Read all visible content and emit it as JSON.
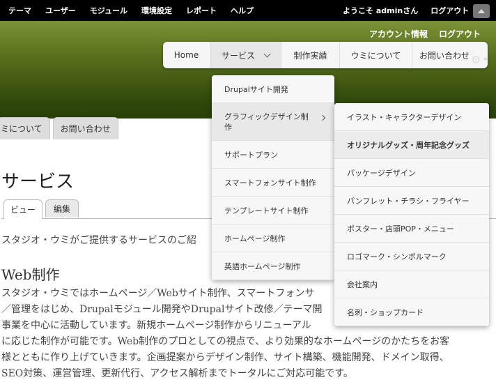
{
  "toolbar": {
    "menu": [
      "テーマ",
      "ユーザー",
      "モジュール",
      "環境設定",
      "レポート",
      "ヘルプ"
    ],
    "welcome": "ようこそ adminさん",
    "logout": "ログアウト"
  },
  "header": {
    "secondary": [
      "アカウント情報",
      "ログアウト"
    ],
    "nav": [
      "Home",
      "サービス",
      "制作実績",
      "ウミについて",
      "お問い合わせ"
    ],
    "left_tabs": [
      "ミについて",
      "お問い合わせ"
    ]
  },
  "content": {
    "title": "サービス",
    "tabs": [
      "ビュー",
      "編集"
    ],
    "intro": "スタジオ・ウミがご提供するサービスのご紹",
    "h2": "Web制作",
    "body": [
      "スタジオ・ウミではホームページ／Webサイト制作、スマートフォンサ",
      "／管理をはじめ、Drupalモジュール開発やDrupalサイト改修／テーマ開",
      "事業を中心に活動しています。新規ホームページ制作からリニューアル",
      "に応じた制作が可能です。Web制作のプロとしての視点で、より効果的なホームページのかたちをお客",
      "様とともに作り上げていきます。企画提案からデザイン制作、サイト構築、機能開発、ドメイン取得、",
      "SEO対策、運営管理、更新代行、アクセス解析までトータルにご対応可能です。"
    ]
  },
  "dropdown": {
    "items": [
      "Drupalサイト開発",
      "グラフィックデザイン制作",
      "サポートプラン",
      "スマートフォンサイト制作",
      "テンプレートサイト制作",
      "ホームページ制作",
      "英語ホームページ制作"
    ]
  },
  "submenu": {
    "items": [
      "イラスト・キャラクターデザイン",
      "オリジナルグッズ・周年記念グッズ",
      "パッケージデザイン",
      "パンフレット・チラシ・フライヤー",
      "ポスター・店頭POP・メニュー",
      "ロゴマーク・シンボルマーク",
      "会社案内",
      "名刺・ショップカード"
    ]
  }
}
